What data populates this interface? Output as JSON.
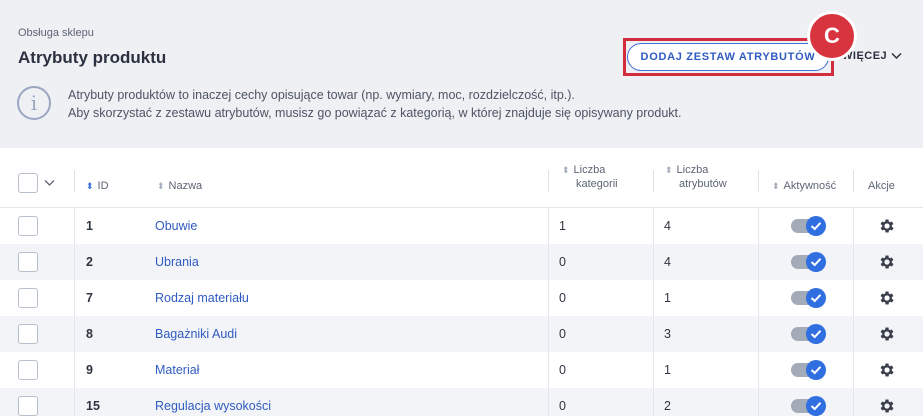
{
  "header": {
    "breadcrumb": "Obsługa sklepu",
    "title": "Atrybuty produktu",
    "add_button": "DODAJ ZESTAW ATRYBUTÓW",
    "marker": "C",
    "more": "WIĘCEJ"
  },
  "info": {
    "line1": "Atrybuty produktów to inaczej cechy opisujące towar (np. wymiary, moc, rozdzielczość, itp.).",
    "line2": "Aby skorzystać z zestawu atrybutów, musisz go powiązać z kategorią, w której znajduje się opisywany produkt."
  },
  "table": {
    "headers": {
      "id": "ID",
      "name": "Nazwa",
      "categories_1": "Liczba",
      "categories_2": "kategorii",
      "attributes_1": "Liczba",
      "attributes_2": "atrybutów",
      "active": "Aktywność",
      "actions": "Akcje"
    },
    "rows": [
      {
        "id": "1",
        "name": "Obuwie",
        "categories": "1",
        "attributes": "4"
      },
      {
        "id": "2",
        "name": "Ubrania",
        "categories": "0",
        "attributes": "4"
      },
      {
        "id": "7",
        "name": "Rodzaj materiału",
        "categories": "0",
        "attributes": "1"
      },
      {
        "id": "8",
        "name": "Bagażniki Audi",
        "categories": "0",
        "attributes": "3"
      },
      {
        "id": "9",
        "name": "Materiał",
        "categories": "0",
        "attributes": "1"
      },
      {
        "id": "15",
        "name": "Regulacja wysokości",
        "categories": "0",
        "attributes": "2"
      }
    ]
  }
}
